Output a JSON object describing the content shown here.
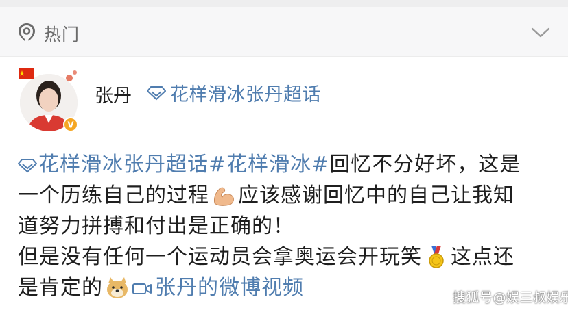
{
  "header": {
    "hot_label": "热门",
    "hot_icon": "location-pin-icon",
    "collapse_icon": "chevron-down-icon"
  },
  "post": {
    "author": "张丹",
    "topic": "花样滑冰张丹超话",
    "avatar_icon": "avatar-photo",
    "verified_badge": "V",
    "lines": {
      "l1_topic": "花样滑冰张丹超话",
      "l1_hashtag": "#花样滑冰#",
      "l1_text": "回忆不分好坏，这是",
      "l2_text_a": "一个历练自己的过程",
      "l2_text_b": "应该感谢回忆中的自己让我知",
      "l3_text": "道努力拼搏和付出是正确的！",
      "l4_text_a": "但是没有任何一个运动员会拿奥运会开玩笑",
      "l4_text_b": "这点还",
      "l5_text_a": "是肯定的",
      "l5_video_link": "张丹的微博视频"
    },
    "emojis": [
      "flexed-biceps-icon",
      "gold-medal-icon",
      "doge-icon"
    ]
  },
  "watermark": "搜狐号@娱三叔娱乐",
  "colors": {
    "link": "#507daf",
    "bar_bg": "#f7f7f8",
    "text": "#1f1f1f"
  }
}
